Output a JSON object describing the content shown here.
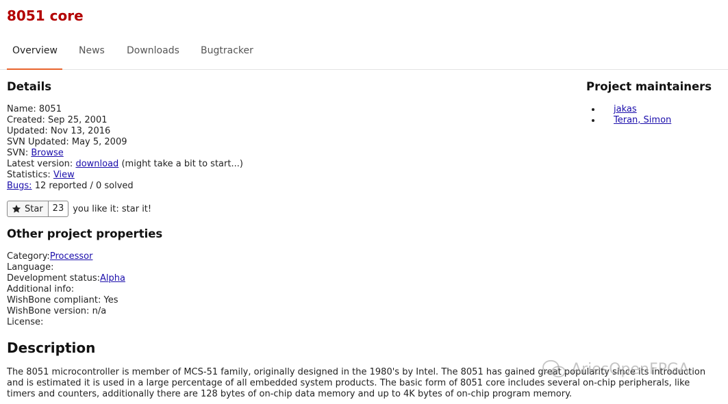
{
  "project": {
    "title": "8051 core"
  },
  "tabs": [
    {
      "label": "Overview",
      "active": true
    },
    {
      "label": "News"
    },
    {
      "label": "Downloads"
    },
    {
      "label": "Bugtracker"
    }
  ],
  "details": {
    "heading": "Details",
    "name_label": "Name:",
    "name_value": "8051",
    "created_label": "Created:",
    "created_value": "Sep 25, 2001",
    "updated_label": "Updated:",
    "updated_value": "Nov 13, 2016",
    "svn_updated_label": "SVN Updated:",
    "svn_updated_value": "May 5, 2009",
    "svn_label": "SVN:",
    "svn_link": "Browse",
    "latest_label": "Latest version:",
    "latest_link": "download",
    "latest_note": "(might take a bit to start...)",
    "stats_label": "Statistics:",
    "stats_link": "View",
    "bugs_link": "Bugs:",
    "bugs_value": "12 reported / 0 solved"
  },
  "star": {
    "label": "Star",
    "count": "23",
    "note": "you like it: star it!"
  },
  "other": {
    "heading": "Other project properties",
    "category_label": "Category:",
    "category_link": "Processor",
    "language_label": "Language:",
    "dev_status_label": "Development status:",
    "dev_status_link": "Alpha",
    "additional_label": "Additional info:",
    "wishbone_label": "WishBone compliant:",
    "wishbone_value": "Yes",
    "wishbone_version_label": "WishBone version:",
    "wishbone_version_value": "n/a",
    "license_label": "License:"
  },
  "maintainers": {
    "heading": "Project maintainers",
    "items": [
      {
        "name": "jakas"
      },
      {
        "name": "Teran, Simon"
      }
    ]
  },
  "description": {
    "heading": "Description",
    "text": "The 8051 microcontroller is member of MCS-51 family, originally designed in the 1980's by Intel. The 8051 has gained great popularity since its introduction and is estimated it is used in a large percentage of all embedded system products. The basic form of 8051 core includes several on-chip peripherals, like timers and counters, additionally there are 128 bytes of on-chip data memory and up to 4K bytes of on-chip program memory."
  },
  "watermark": {
    "text": "AriesOpenFPGA"
  }
}
